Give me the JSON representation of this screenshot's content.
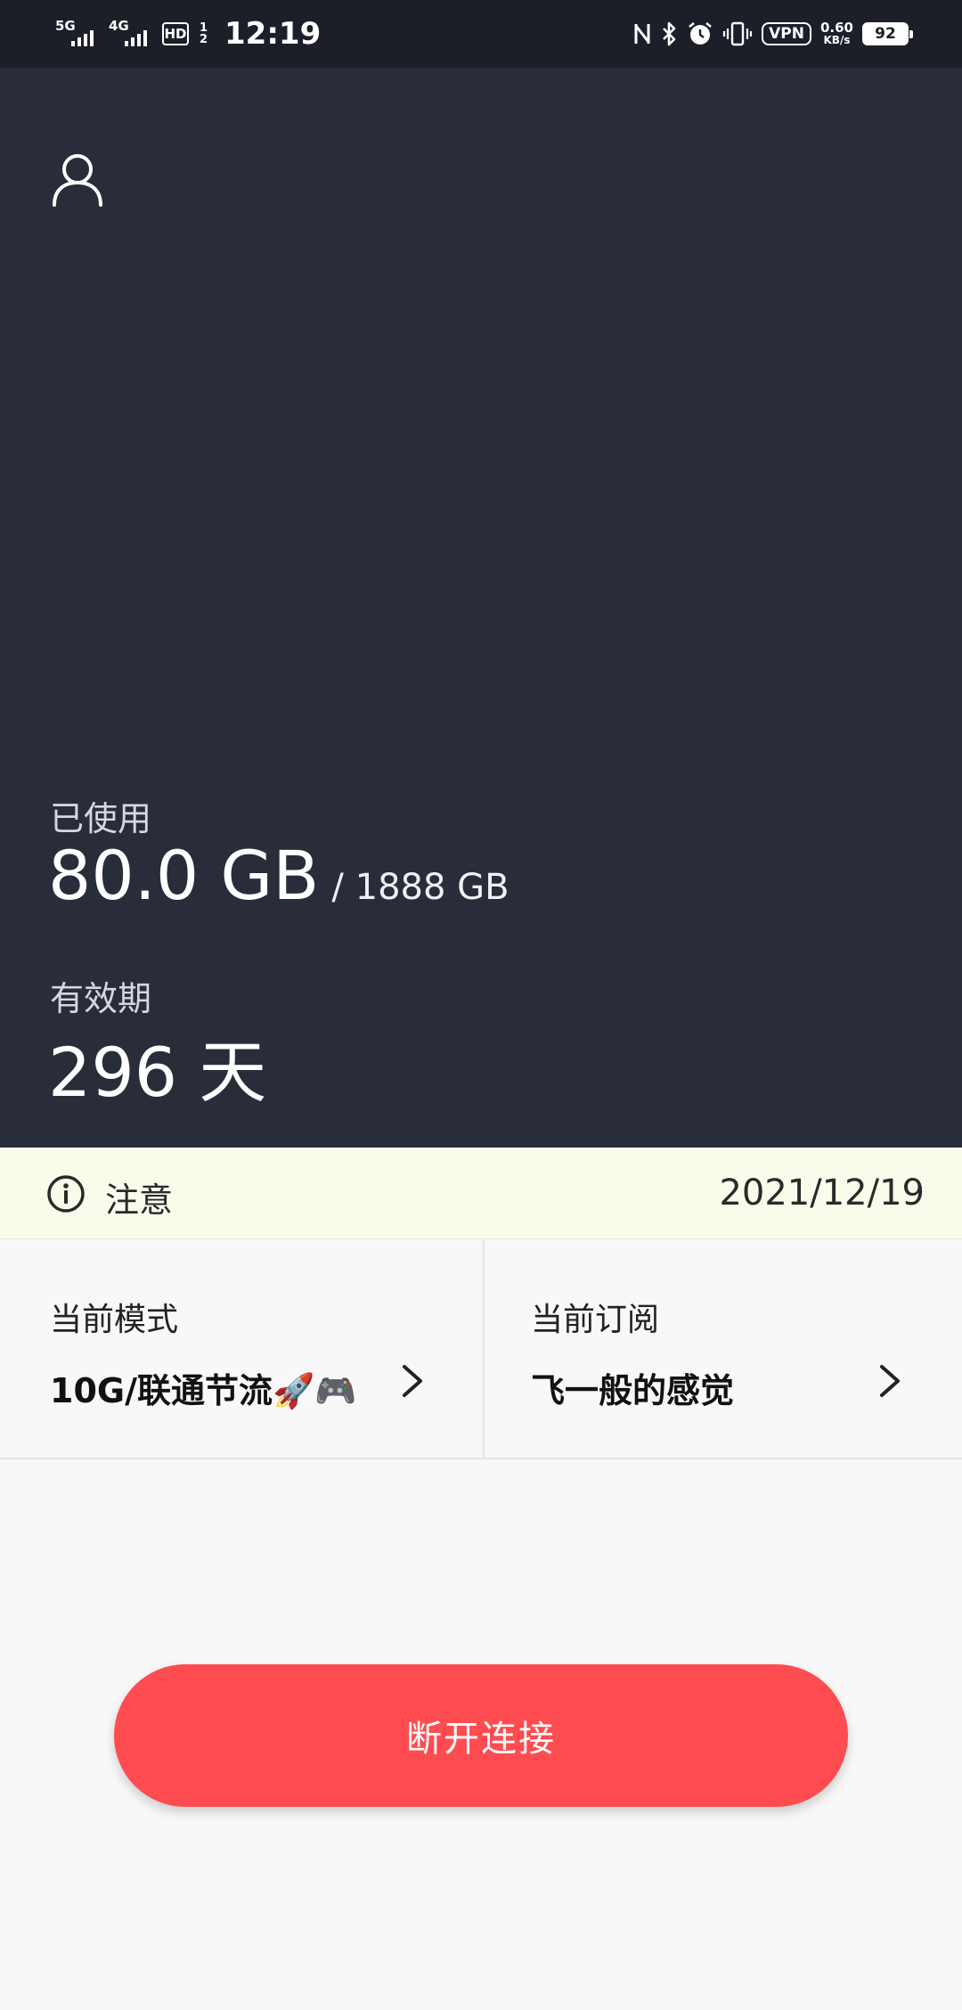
{
  "status_bar": {
    "signal_1_label": "5G",
    "signal_2_label": "4G",
    "hd_label": "HD",
    "hd_sub": "1 2",
    "time": "12:19",
    "vpn_label": "VPN",
    "speed_value": "0.60",
    "speed_unit": "KB/s",
    "battery_level": "92",
    "icons": [
      "nfc-icon",
      "bluetooth-icon",
      "alarm-icon",
      "vibrate-icon",
      "vpn-icon",
      "battery-icon"
    ]
  },
  "hero": {
    "profile_icon": "user-icon",
    "used_label": "已使用",
    "used_value": "80.0 GB",
    "used_total": "/ 1888 GB",
    "validity_label": "有效期",
    "validity_value": "296 天"
  },
  "notice": {
    "icon": "info-icon",
    "label": "注意",
    "date": "2021/12/19"
  },
  "mode_card": {
    "label": "当前模式",
    "value": "10G/联通节流🚀🎮"
  },
  "subscription_card": {
    "label": "当前订阅",
    "value": "飞一般的感觉"
  },
  "disconnect_button": {
    "label": "断开连接"
  },
  "colors": {
    "hero_bg": "#282d39",
    "status_bg": "#1c1f28",
    "notice_bg": "#fbfbec",
    "page_bg": "#f8f8f8",
    "accent": "#fe4c50"
  }
}
